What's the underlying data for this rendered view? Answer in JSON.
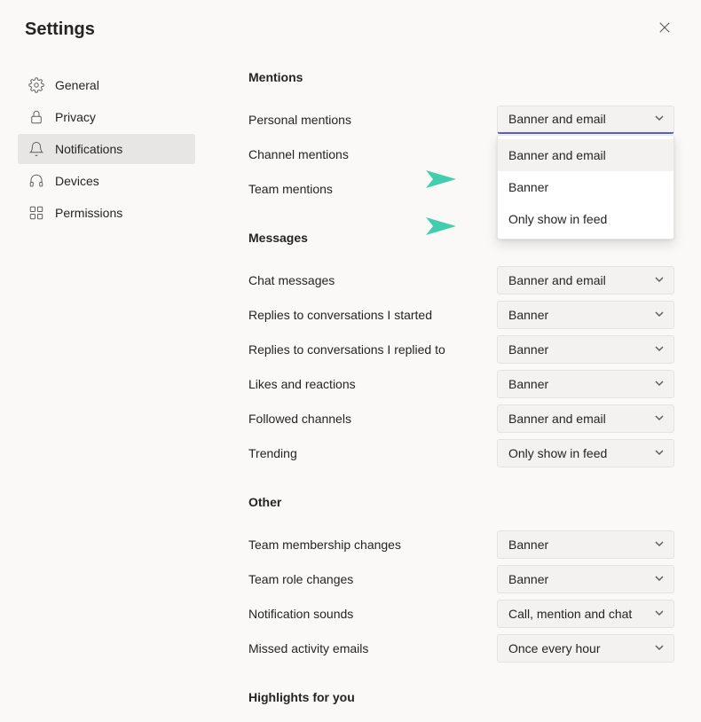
{
  "header": {
    "title": "Settings"
  },
  "sidebar": {
    "items": [
      {
        "label": "General",
        "icon": "gear-icon",
        "active": false
      },
      {
        "label": "Privacy",
        "icon": "lock-icon",
        "active": false
      },
      {
        "label": "Notifications",
        "icon": "bell-icon",
        "active": true
      },
      {
        "label": "Devices",
        "icon": "headset-icon",
        "active": false
      },
      {
        "label": "Permissions",
        "icon": "apps-icon",
        "active": false
      }
    ]
  },
  "sections": {
    "mentions": {
      "title": "Mentions",
      "rows": [
        {
          "label": "Personal mentions",
          "value": "Banner and email",
          "open": true
        },
        {
          "label": "Channel mentions"
        },
        {
          "label": "Team mentions"
        }
      ],
      "dropdown_options": [
        "Banner and email",
        "Banner",
        "Only show in feed"
      ]
    },
    "messages": {
      "title": "Messages",
      "rows": [
        {
          "label": "Chat messages",
          "value": "Banner and email"
        },
        {
          "label": "Replies to conversations I started",
          "value": "Banner"
        },
        {
          "label": "Replies to conversations I replied to",
          "value": "Banner"
        },
        {
          "label": "Likes and reactions",
          "value": "Banner"
        },
        {
          "label": "Followed channels",
          "value": "Banner and email"
        },
        {
          "label": "Trending",
          "value": "Only show in feed"
        }
      ]
    },
    "other": {
      "title": "Other",
      "rows": [
        {
          "label": "Team membership changes",
          "value": "Banner"
        },
        {
          "label": "Team role changes",
          "value": "Banner"
        },
        {
          "label": "Notification sounds",
          "value": "Call, mention and chat"
        },
        {
          "label": "Missed activity emails",
          "value": "Once every hour"
        }
      ]
    },
    "highlights": {
      "title": "Highlights for you"
    }
  }
}
